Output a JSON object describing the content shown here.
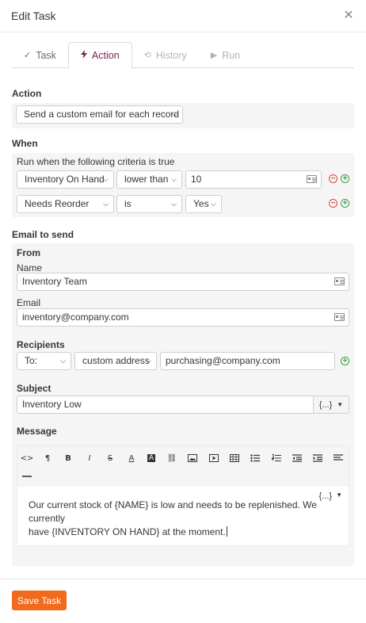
{
  "dialog": {
    "title": "Edit Task"
  },
  "tabs": [
    {
      "label": "Task",
      "icon": "check-icon"
    },
    {
      "label": "Action",
      "icon": "bolt-icon"
    },
    {
      "label": "History",
      "icon": "history-icon"
    },
    {
      "label": "Run",
      "icon": "play-icon"
    }
  ],
  "action": {
    "heading": "Action",
    "selected": "Send a custom email for each record"
  },
  "when": {
    "heading": "When",
    "intro": "Run when the following criteria is true",
    "rules": [
      {
        "field": "Inventory On Hand",
        "operator": "lower than",
        "value": "10"
      },
      {
        "field": "Needs Reorder",
        "operator": "is",
        "value": "Yes"
      }
    ]
  },
  "email": {
    "heading": "Email to send",
    "from": {
      "heading": "From",
      "name_label": "Name",
      "name_value": "Inventory Team",
      "email_label": "Email",
      "email_value": "inventory@company.com"
    },
    "recipients": {
      "heading": "Recipients",
      "type": "To:",
      "mode": "custom address",
      "address": "purchasing@company.com"
    },
    "subject": {
      "heading": "Subject",
      "value": "Inventory Low",
      "braces": "{...}"
    },
    "message": {
      "heading": "Message",
      "braces": "{...}",
      "line1": "Our current stock of {NAME} is low and needs to be replenished. We currently",
      "line2": "have {INVENTORY ON HAND} at the moment."
    }
  },
  "footer": {
    "save_label": "Save Task"
  },
  "colors": {
    "accent": "#7a1e4e",
    "save": "#f26a1b",
    "remove": "#e0453c",
    "add": "#3aa04a"
  }
}
